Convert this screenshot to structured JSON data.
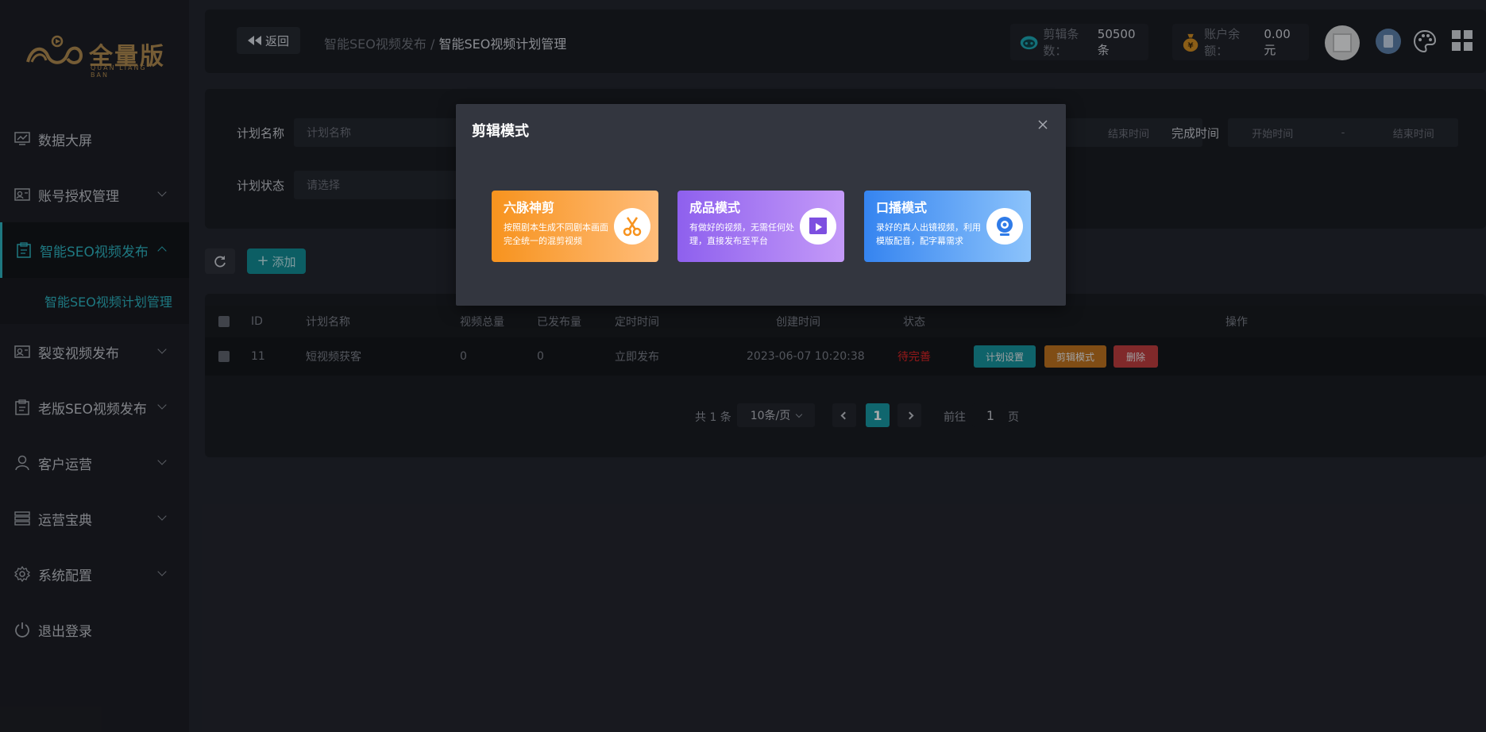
{
  "sidebar": {
    "logo": {
      "text": "全量版",
      "sub": "QUAN LIANG BAN"
    },
    "items": [
      {
        "label": "数据大屏",
        "icon": "monitor-chart-icon",
        "chevron": false
      },
      {
        "label": "账号授权管理",
        "icon": "id-card-icon",
        "chevron": true
      },
      {
        "label": "智能SEO视频发布",
        "icon": "clipboard-icon",
        "chevron": true,
        "active": true
      },
      {
        "label": "裂变视频发布",
        "icon": "id-card-icon",
        "chevron": true
      },
      {
        "label": "老版SEO视频发布",
        "icon": "clipboard-icon",
        "chevron": true
      },
      {
        "label": "客户运营",
        "icon": "user-icon",
        "chevron": true
      },
      {
        "label": "运营宝典",
        "icon": "layers-icon",
        "chevron": true
      },
      {
        "label": "系统配置",
        "icon": "gear-icon",
        "chevron": true
      },
      {
        "label": "退出登录",
        "icon": "power-icon",
        "chevron": false
      }
    ],
    "submenu": {
      "label": "智能SEO视频计划管理"
    }
  },
  "header": {
    "back_label": "返回",
    "breadcrumb_parent": "智能SEO视频发布 /",
    "breadcrumb_current": "智能SEO视频计划管理",
    "clip_label": "剪辑条数：",
    "clip_value": "50500条",
    "balance_label": "账户余额：",
    "balance_value": "0.00元"
  },
  "filter": {
    "plan_name_label": "计划名称",
    "plan_name_placeholder": "计划名称",
    "plan_status_label": "计划状态",
    "plan_status_placeholder": "请选择",
    "end_time_partial": "结束时间",
    "complete_time_label": "完成时间",
    "start_placeholder": "开始时间",
    "date_sep": "-",
    "end_placeholder": "结束时间"
  },
  "toolbar": {
    "add_label": "添加"
  },
  "table": {
    "headers": [
      "ID",
      "计划名称",
      "视频总量",
      "已发布量",
      "定时时间",
      "创建时间",
      "状态",
      "操作"
    ],
    "rows": [
      {
        "id": "11",
        "name": "短视频获客",
        "total": "0",
        "published": "0",
        "schedule": "立即发布",
        "created": "2023-06-07 10:20:38",
        "status": "待完善"
      }
    ],
    "actions": {
      "settings": "计划设置",
      "edit_mode": "剪辑模式",
      "delete": "删除"
    }
  },
  "pagination": {
    "total": "共 1 条",
    "page_size": "10条/页",
    "current_page": "1",
    "goto_label": "前往",
    "goto_value": "1",
    "page_suffix": "页"
  },
  "modal": {
    "title": "剪辑模式",
    "cards": [
      {
        "title": "六脉神剪",
        "desc": "按照剧本生成不同剧本画面完全统一的混剪视频",
        "icon": "scissors-icon",
        "color": "#f7931e"
      },
      {
        "title": "成品模式",
        "desc": "有做好的视频，无需任何处理，直接发布至平台",
        "icon": "video-play-icon",
        "color": "#9b6cf0"
      },
      {
        "title": "口播模式",
        "desc": "录好的真人出镜视频，利用模版配音，配字幕需求",
        "icon": "webcam-icon",
        "color": "#3d8ef0"
      }
    ]
  },
  "colors": {
    "accent": "#2ab3bf",
    "primary_btn": "#0f8a92",
    "warn_btn": "#c0711a",
    "danger_btn": "#c03a3a",
    "status_red": "#e02020"
  }
}
